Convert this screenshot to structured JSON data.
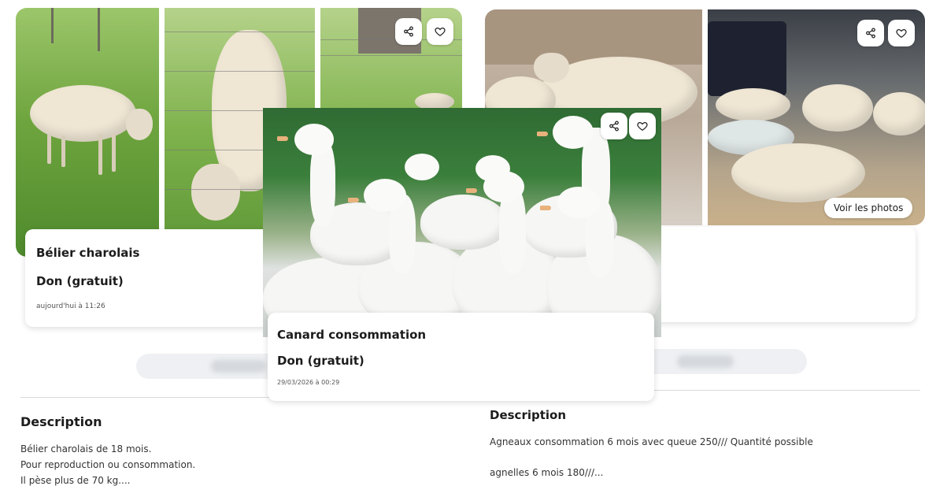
{
  "left_listing": {
    "title": "Bélier charolais",
    "price": "Don (gratuit)",
    "date": "aujourd'hui à 11:26",
    "description_heading": "Description",
    "description_lines": [
      "Bélier charolais de 18 mois.",
      "Pour reproduction ou consommation.",
      "Il pèse plus de 70 kg...."
    ]
  },
  "popup_listing": {
    "title": "Canard consommation",
    "price": "Don (gratuit)",
    "date": "29/03/2026 à 00:29"
  },
  "right_listing": {
    "see_photos_label": "Voir les photos",
    "description_heading": "Description",
    "description_lines": [
      "Agneaux consommation 6 mois avec queue 250/// Quantité possible",
      "agnelles 6 mois 180///..."
    ]
  },
  "icons": {
    "share": "share-icon",
    "favorite": "heart-icon"
  }
}
